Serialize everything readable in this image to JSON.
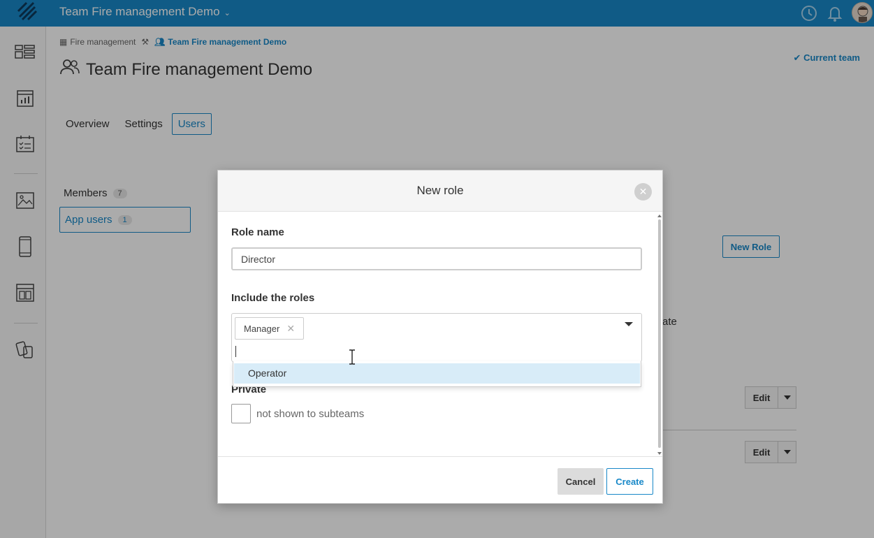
{
  "topbar": {
    "team_name": "Team Fire management Demo",
    "icons": [
      "logo-icon",
      "history-icon",
      "bell-icon",
      "avatar"
    ]
  },
  "sidebar": {
    "icons": [
      "dashboard-icon",
      "analytics-icon",
      "checklist-icon",
      "gallery-icon",
      "mobile-icon",
      "layout-icon",
      "devices-icon"
    ]
  },
  "breadcrumb": {
    "parent": "Fire management",
    "current": "Team Fire management Demo"
  },
  "page": {
    "title": "Team Fire management Demo",
    "current_team_label": "Current team"
  },
  "tabs": [
    {
      "label": "Overview"
    },
    {
      "label": "Settings"
    },
    {
      "label": "Users"
    }
  ],
  "members": {
    "label": "Members",
    "count": "7"
  },
  "app_users": {
    "label": "App users",
    "count": "1"
  },
  "actions": {
    "new_role": "New Role",
    "edit": "Edit"
  },
  "background_text": "ate",
  "modal": {
    "title": "New role",
    "role_name_label": "Role name",
    "role_name_value": "Director",
    "include_roles_label": "Include the roles",
    "selected_roles": [
      "Manager"
    ],
    "dropdown_options": [
      "Operator"
    ],
    "private_label": "Private",
    "private_checkbox_text": "not shown to subteams",
    "cancel": "Cancel",
    "create": "Create"
  },
  "colors": {
    "primary": "#1888c8",
    "highlight": "#d8ecf8"
  }
}
